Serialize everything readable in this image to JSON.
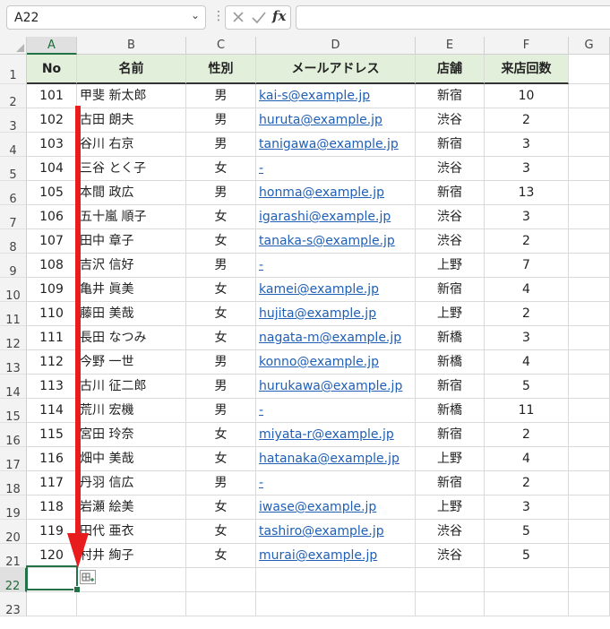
{
  "name_box": {
    "value": "A22"
  },
  "formula_bar": {
    "fx_label": "fx",
    "value": ""
  },
  "columns": [
    "A",
    "B",
    "C",
    "D",
    "E",
    "F",
    "G"
  ],
  "selected_column": "A",
  "row_numbers": [
    "1",
    "2",
    "3",
    "4",
    "5",
    "6",
    "7",
    "8",
    "9",
    "10",
    "11",
    "12",
    "13",
    "14",
    "15",
    "16",
    "17",
    "18",
    "19",
    "20",
    "21",
    "22",
    "23"
  ],
  "selected_row": "22",
  "table_header": [
    "No",
    "名前",
    "性別",
    "メールアドレス",
    "店舗",
    "来店回数"
  ],
  "rows": [
    [
      "101",
      "甲斐 新太郎",
      "男",
      "kai-s@example.jp",
      "新宿",
      "10"
    ],
    [
      "102",
      "古田 朗夫",
      "男",
      "huruta@example.jp",
      "渋谷",
      "2"
    ],
    [
      "103",
      "谷川 右京",
      "男",
      "tanigawa@example.jp",
      "新宿",
      "3"
    ],
    [
      "104",
      "三谷 とく子",
      "女",
      "-",
      "渋谷",
      "3"
    ],
    [
      "105",
      "本間 政広",
      "男",
      "honma@example.jp",
      "新宿",
      "13"
    ],
    [
      "106",
      "五十嵐 順子",
      "女",
      "igarashi@example.jp",
      "渋谷",
      "3"
    ],
    [
      "107",
      "田中 章子",
      "女",
      "tanaka-s@example.jp",
      "渋谷",
      "2"
    ],
    [
      "108",
      "吉沢 信好",
      "男",
      "-",
      "上野",
      "7"
    ],
    [
      "109",
      "亀井 眞美",
      "女",
      "kamei@example.jp",
      "新宿",
      "4"
    ],
    [
      "110",
      "藤田 美哉",
      "女",
      "hujita@example.jp",
      "上野",
      "2"
    ],
    [
      "111",
      "長田 なつみ",
      "女",
      "nagata-m@example.jp",
      "新橋",
      "3"
    ],
    [
      "112",
      "今野 一世",
      "男",
      "konno@example.jp",
      "新橋",
      "4"
    ],
    [
      "113",
      "古川 征二郎",
      "男",
      "hurukawa@example.jp",
      "新宿",
      "5"
    ],
    [
      "114",
      "荒川 宏機",
      "男",
      "-",
      "新橋",
      "11"
    ],
    [
      "115",
      "宮田 玲奈",
      "女",
      "miyata-r@example.jp",
      "新宿",
      "2"
    ],
    [
      "116",
      "畑中 美哉",
      "女",
      "hatanaka@example.jp",
      "上野",
      "4"
    ],
    [
      "117",
      "丹羽 信広",
      "男",
      "-",
      "新宿",
      "2"
    ],
    [
      "118",
      "岩瀬 絵美",
      "女",
      "iwase@example.jp",
      "上野",
      "3"
    ],
    [
      "119",
      "田代 亜衣",
      "女",
      "tashiro@example.jp",
      "渋谷",
      "5"
    ],
    [
      "120",
      "村井 絢子",
      "女",
      "murai@example.jp",
      "渋谷",
      "5"
    ]
  ],
  "colors": {
    "header_fill": "#e2efda",
    "selection": "#217346",
    "link": "#1f5fb5",
    "arrow": "#e81c1c"
  },
  "icons": {
    "cancel": "x-icon",
    "confirm": "check-icon",
    "autofill_options": "autofill-options-icon",
    "arrow": "down-arrow-annotation"
  }
}
